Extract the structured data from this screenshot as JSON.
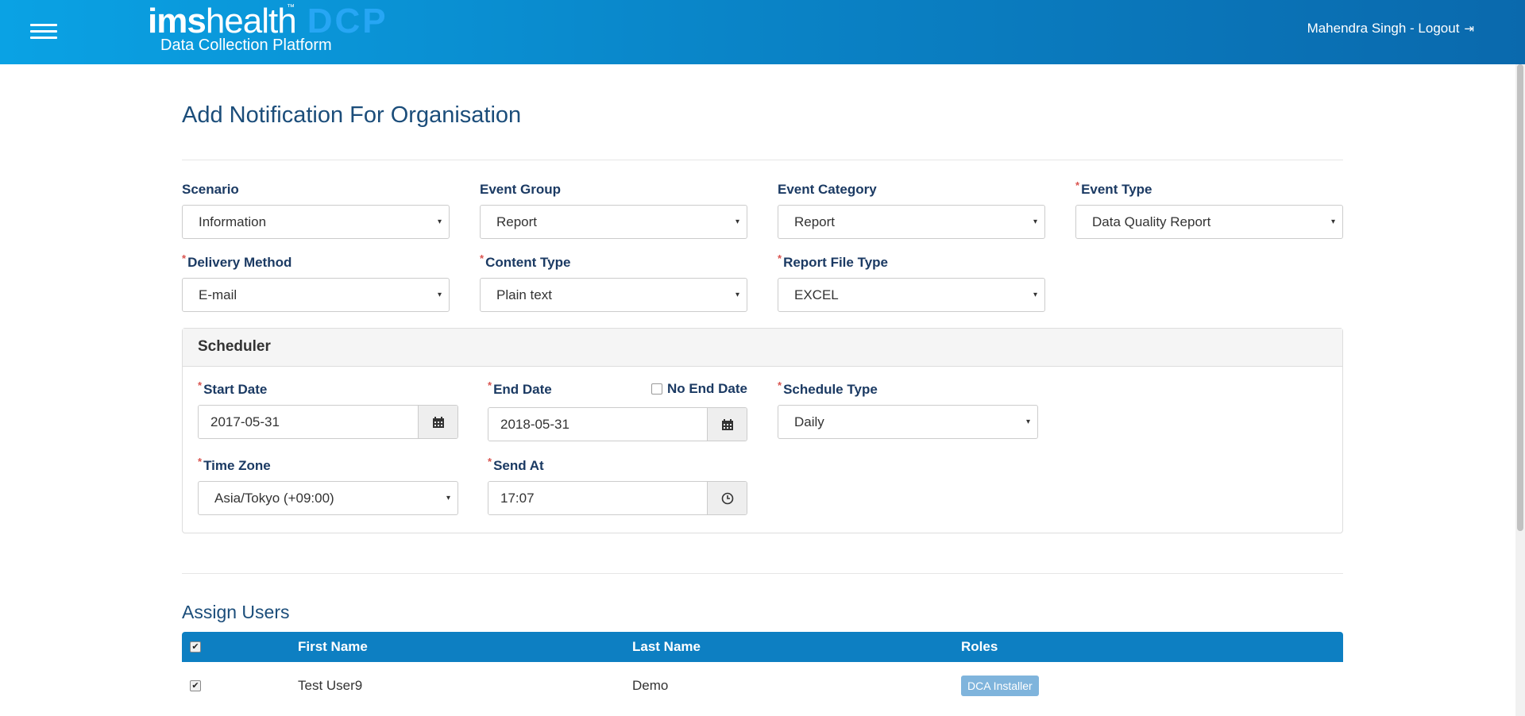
{
  "header": {
    "logo_ims": "ims",
    "logo_health": "health",
    "logo_tm": "™",
    "logo_dcp": "DCP",
    "logo_subtitle": "Data Collection Platform",
    "user_text": "Mahendra Singh - Logout",
    "logout_icon": "⇥"
  },
  "page": {
    "title": "Add Notification For Organisation"
  },
  "form": {
    "scenario": {
      "label": "Scenario",
      "value": "Information"
    },
    "event_group": {
      "label": "Event Group",
      "value": "Report"
    },
    "event_category": {
      "label": "Event Category",
      "value": "Report"
    },
    "event_type": {
      "label": "Event Type",
      "value": "Data Quality Report",
      "required": "*"
    },
    "delivery_method": {
      "label": "Delivery Method",
      "value": "E-mail",
      "required": "*"
    },
    "content_type": {
      "label": "Content Type",
      "value": "Plain text",
      "required": "*"
    },
    "report_file_type": {
      "label": "Report File Type",
      "value": "EXCEL",
      "required": "*"
    }
  },
  "scheduler": {
    "title": "Scheduler",
    "start_date": {
      "label": "Start Date",
      "value": "2017-05-31",
      "required": "*"
    },
    "end_date": {
      "label": "End Date",
      "value": "2018-05-31",
      "required": "*"
    },
    "no_end_date": {
      "label": "No End Date",
      "checked": false
    },
    "schedule_type": {
      "label": "Schedule Type",
      "value": "Daily",
      "required": "*"
    },
    "time_zone": {
      "label": "Time Zone",
      "value": "Asia/Tokyo (+09:00)",
      "required": "*"
    },
    "send_at": {
      "label": "Send At",
      "value": "17:07",
      "required": "*"
    }
  },
  "assign_users": {
    "title": "Assign Users",
    "columns": [
      "First Name",
      "Last Name",
      "Roles"
    ],
    "header_checkbox": "✔",
    "rows": [
      {
        "checked": "✔",
        "first_name": "Test User9",
        "last_name": "Demo",
        "role": "DCA Installer"
      }
    ]
  },
  "icons": {
    "caret": "▾",
    "calendar": "calendar-icon",
    "clock": "clock-icon"
  },
  "colors": {
    "header_start": "#0aa2e4",
    "header_end": "#0a69ad",
    "table_header": "#0d7fc2",
    "label": "#1b3a63",
    "title": "#1b4d7a",
    "role_badge": "#7fb4dc",
    "required": "#d9534f"
  }
}
